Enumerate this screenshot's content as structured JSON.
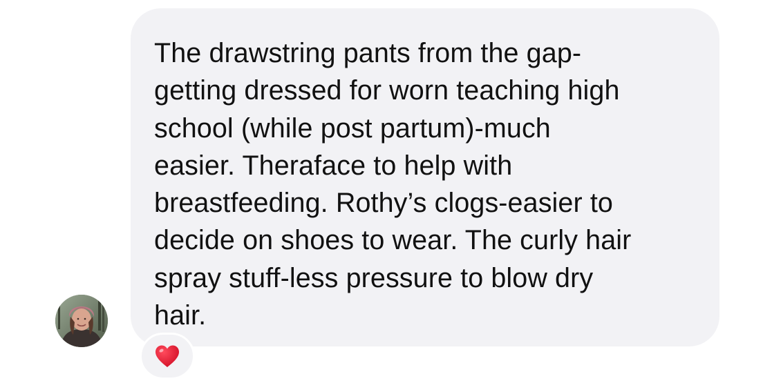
{
  "message": {
    "lines": [
      "The drawstring pants from the gap-",
      "getting dressed for worn teaching high",
      "school (while post partum)-much",
      "easier. Theraface to help with",
      "breastfeeding. Rothy’s clogs-easier to",
      "decide on shoes to wear. The curly hair",
      "spray stuff-less pressure to blow dry",
      "hair."
    ],
    "bubble_color": "#f2f2f5",
    "text_color": "#111111"
  },
  "sender": {
    "avatar_icon": "profile-photo"
  },
  "reaction": {
    "icon": "red-heart-icon",
    "color": "#e0112b"
  }
}
